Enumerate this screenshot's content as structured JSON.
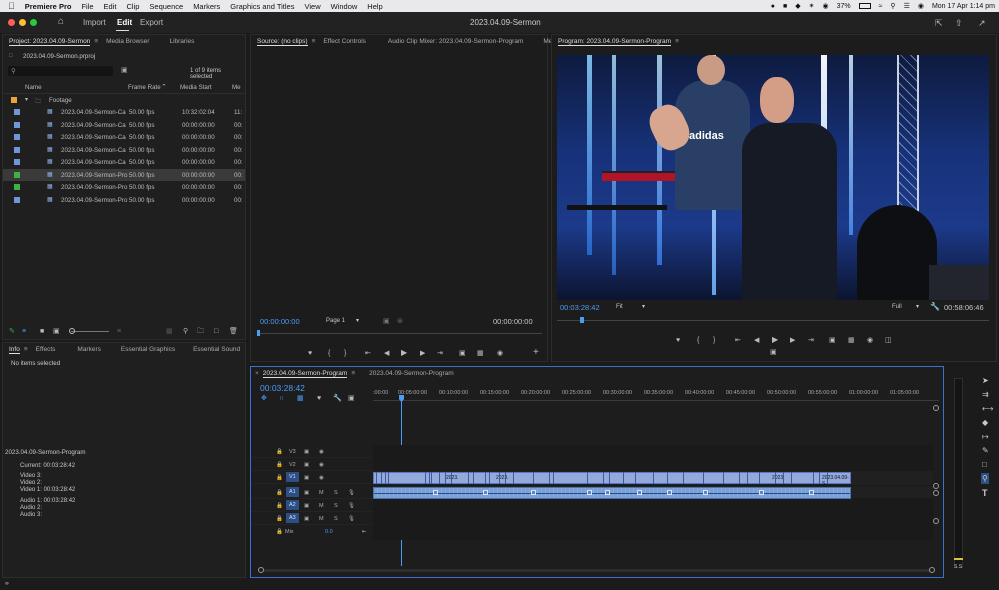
{
  "menubar": {
    "items": [
      "Premiere Pro",
      "File",
      "Edit",
      "Clip",
      "Sequence",
      "Markers",
      "Graphics and Titles",
      "View",
      "Window",
      "Help"
    ],
    "battery": "37%",
    "datetime": "Mon 17 Apr  1:14 pm"
  },
  "workspace": {
    "import": "Import",
    "edit": "Edit",
    "export": "Export",
    "title": "2023.04.09-Sermon"
  },
  "project": {
    "tabs": [
      "Project: 2023.04.09-Sermon",
      "Media Browser",
      "Libraries"
    ],
    "file": "2023.04.09-Sermon.prproj",
    "selection": "1 of 9 items selected",
    "columns": {
      "name": "Name",
      "frame_rate": "Frame Rate",
      "media_start": "Media Start",
      "more": "Me"
    },
    "folder": "Footage",
    "items": [
      {
        "name": "2023.04.09-Sermon-Ca",
        "fps": "50.00 fps",
        "start": "10:32:02:04",
        "extra": "11:",
        "color": "#6f96d6"
      },
      {
        "name": "2023.04.09-Sermon-Ca",
        "fps": "50.00 fps",
        "start": "00:00:00:00",
        "extra": "00:",
        "color": "#6f96d6"
      },
      {
        "name": "2023.04.09-Sermon-Ca",
        "fps": "50.00 fps",
        "start": "00:00:00:00",
        "extra": "00:",
        "color": "#6f96d6"
      },
      {
        "name": "2023.04.09-Sermon-Ca",
        "fps": "50.00 fps",
        "start": "00:00:00:00",
        "extra": "00:",
        "color": "#6f96d6"
      },
      {
        "name": "2023.04.09-Sermon-Ca",
        "fps": "50.00 fps",
        "start": "00:00:00:00",
        "extra": "00:",
        "color": "#6f96d6"
      },
      {
        "name": "2023.04.09-Sermon-Pro",
        "fps": "50.00 fps",
        "start": "00:00:00:00",
        "extra": "00:",
        "color": "#3eb046"
      },
      {
        "name": "2023.04.09-Sermon-Pro",
        "fps": "50.00 fps",
        "start": "00:00:00:00",
        "extra": "00:",
        "color": "#3eb046"
      },
      {
        "name": "2023.04.09-Sermon-Pro",
        "fps": "50.00 fps",
        "start": "00:00:00:00",
        "extra": "00:",
        "color": "#6f96d6"
      }
    ]
  },
  "info": {
    "tabs": [
      "Info",
      "Effects",
      "Markers",
      "Essential Graphics",
      "Essential Sound"
    ],
    "empty": "No items selected",
    "sequence": "2023.04.09-Sermon-Program",
    "current": "Current:  00:03:28:42",
    "video3": "Video 3:",
    "video2": "Video 2:",
    "video1": "Video 1:  00:03:28:42",
    "audio1": "Audio 1:  00:03:28:42",
    "audio2": "Audio 2:",
    "audio3": "Audio 3:"
  },
  "source": {
    "tabs": [
      "Source: (no clips)",
      "Effect Controls",
      "Audio Clip Mixer: 2023.04.09-Sermon-Program",
      "Me"
    ],
    "timecode_left": "00:00:00:00",
    "page": "Page 1",
    "timecode_right": "00:00:00:00"
  },
  "program": {
    "tab": "Program: 2023.04.09-Sermon-Program",
    "timecode": "00:03:28:42",
    "fit": "Fit",
    "quality": "Full",
    "duration": "00:58:06:46",
    "shirt_text": "adidas"
  },
  "timeline": {
    "tabs": [
      "2023.04.09-Sermon-Program",
      "2023.04.09-Sermon-Program"
    ],
    "timecode": "00:03:28:42",
    "ruler": [
      ":00:00",
      "00:05:00:00",
      "00:10:00:00",
      "00:15:00:00",
      "00:20:00:00",
      "00:25:00:00",
      "00:30:00:00",
      "00:35:00:00",
      "00:40:00:00",
      "00:45:00:00",
      "00:50:00:00",
      "00:55:00:00",
      "01:00:00:00",
      "01:05:00:00"
    ],
    "tracks": {
      "v3": "V3",
      "v2": "V2",
      "v1": "V1",
      "a1": "A1",
      "a2": "A2",
      "a3": "A3",
      "mix": "Mix",
      "mix_value": "0.0",
      "m": "M",
      "s": "S"
    },
    "clip_labels": [
      "2023.",
      "2023.",
      "2023.",
      "2023.04.09-S"
    ]
  },
  "meter": {
    "labels": "S S"
  },
  "colors": {
    "accent": "#4b9cf5",
    "video_clip": "#93a9dc",
    "audio_clip": "#7aa0d8",
    "label_green": "#3eb046",
    "label_blue": "#6f96d6"
  }
}
